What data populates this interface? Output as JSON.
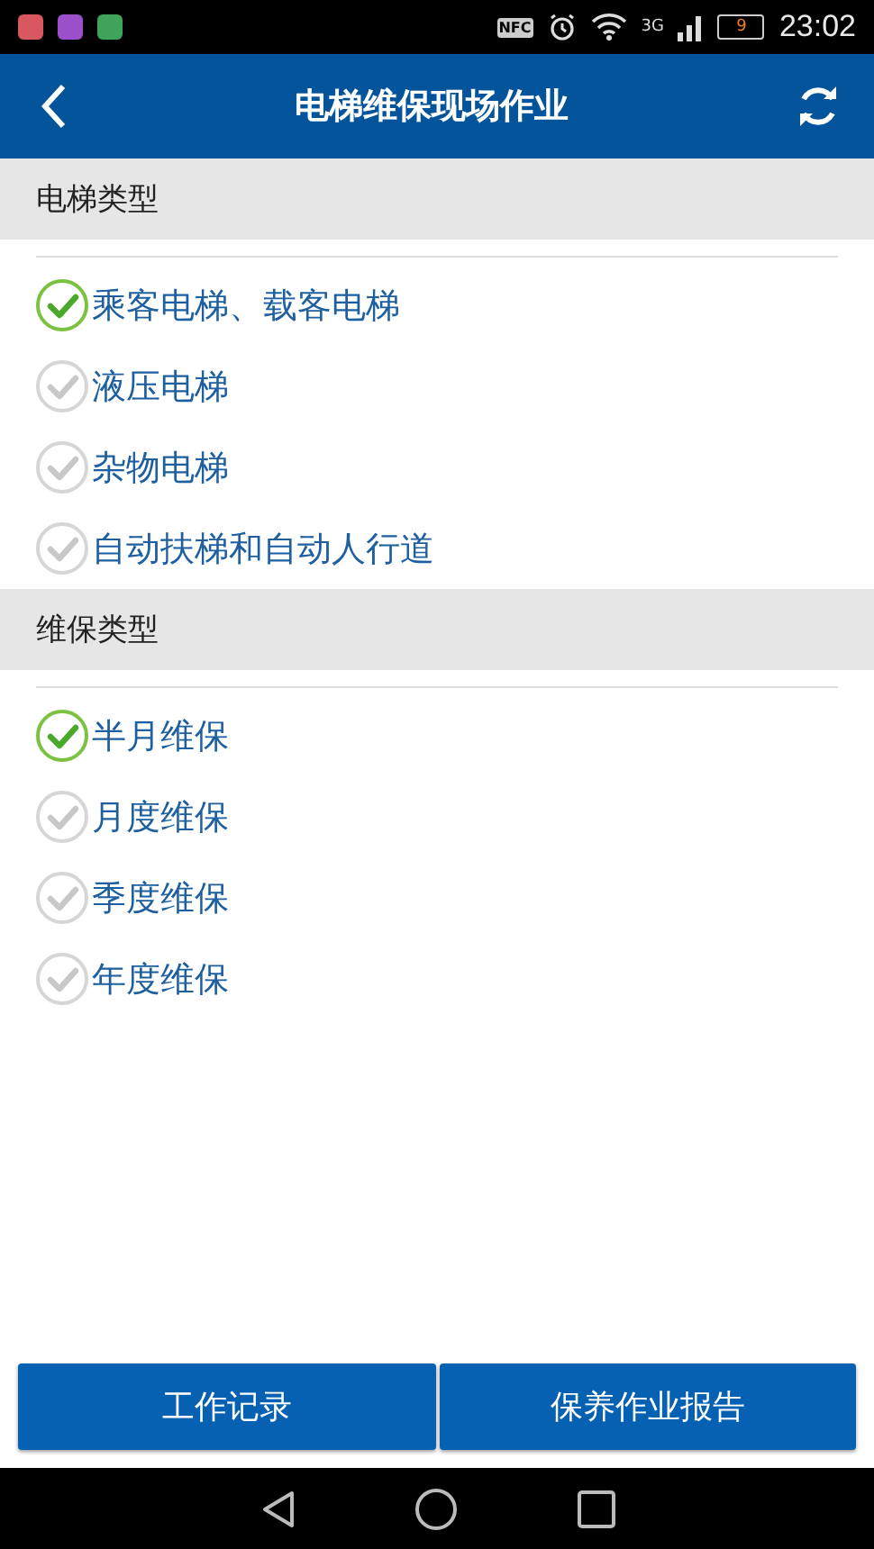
{
  "status_bar": {
    "notifications": [
      {
        "color": "#d9585f"
      },
      {
        "color": "#9b4fc9"
      },
      {
        "color": "#3fa35a"
      }
    ],
    "nfc": "NFC",
    "network": "3G",
    "battery": "9",
    "time": "23:02"
  },
  "header": {
    "title": "电梯维保现场作业"
  },
  "sections": [
    {
      "title": "电梯类型",
      "options": [
        {
          "label": "乘客电梯、载客电梯",
          "checked": true
        },
        {
          "label": "液压电梯",
          "checked": false
        },
        {
          "label": "杂物电梯",
          "checked": false
        },
        {
          "label": "自动扶梯和自动人行道",
          "checked": false
        }
      ]
    },
    {
      "title": "维保类型",
      "options": [
        {
          "label": "半月维保",
          "checked": true
        },
        {
          "label": "月度维保",
          "checked": false
        },
        {
          "label": "季度维保",
          "checked": false
        },
        {
          "label": "年度维保",
          "checked": false
        }
      ]
    }
  ],
  "buttons": [
    "工作记录",
    "保养作业报告"
  ]
}
